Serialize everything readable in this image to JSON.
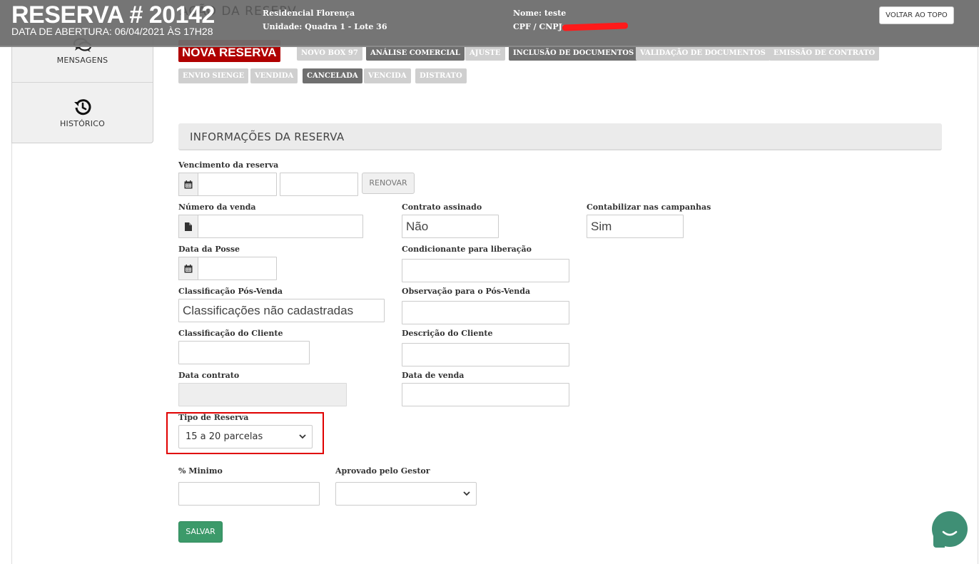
{
  "header": {
    "reservation_title": "RESERVA # 20142",
    "opening_date": "DATA DE ABERTURA: 06/04/2021 ÀS 17H28",
    "background_heading": "AÇÃO DA RESERV",
    "project": "Residencial Florença",
    "unit_line": "Unidade: Quadra 1 - Lote 36",
    "client_name": "Nome: teste",
    "client_doc_label": "CPF / CNPJ:",
    "back_to_top": "VOLTAR AO TOPO"
  },
  "sidebar": {
    "messages_label": "MENSAGENS",
    "history_label": "HISTÓRICO"
  },
  "status_tags": {
    "nova_reserva": "NOVA RESERVA",
    "novo_box": "NOVO BOX 97",
    "analise_comercial": "ANÁLISE COMERCIAL",
    "ajuste": "AJUSTE",
    "inclusao_documentos": "INCLUSÃO DE DOCUMENTOS",
    "validacao_documentos": "VALIDAÇÃO DE DOCUMENTOS",
    "emissao_contrato": "EMISSÃO DE CONTRATO",
    "envio_sienge": "ENVIO SIENGE",
    "vendida": "VENDIDA",
    "cancelada": "CANCELADA",
    "vencida": "VENCIDA",
    "distrato": "DISTRATO"
  },
  "section": {
    "title": "INFORMAÇÕES DA RESERVA"
  },
  "form": {
    "vencimento_label": "Vencimento da reserva",
    "renovar_label": "RENOVAR",
    "numero_venda_label": "Número da venda",
    "contrato_assinado_label": "Contrato assinado",
    "contrato_assinado_value": "Não",
    "contabilizar_label": "Contabilizar nas campanhas",
    "contabilizar_value": "Sim",
    "data_posse_label": "Data da Posse",
    "condicionante_label": "Condicionante para liberação",
    "classificacao_pos_venda_label": "Classificação Pós-Venda",
    "classificacao_pos_venda_value": "Classificações não cadastradas",
    "observacao_pos_venda_label": "Observação para o Pós-Venda",
    "classificacao_cliente_label": "Classificação do Cliente",
    "descricao_cliente_label": "Descrição do Cliente",
    "data_contrato_label": "Data contrato",
    "data_venda_label": "Data de venda",
    "tipo_reserva_label": "Tipo de Reserva",
    "tipo_reserva_value": "15 a 20 parcelas",
    "percentual_minimo_label": "% Minimo",
    "aprovado_gestor_label": "Aprovado pelo Gestor",
    "aprovado_gestor_value": "",
    "salvar_label": "SALVAR"
  },
  "colors": {
    "nova_reserva": "#b00000",
    "tag_dark": "#6f6f6f",
    "tag_light": "#cfcfcf",
    "salvar": "#3c9a6a",
    "highlight": "#e00000",
    "chat": "#3f8f75"
  },
  "icons": {
    "messages": "chat-bubbles-icon",
    "history": "history-clock-icon",
    "calendar": "calendar-icon",
    "document": "file-icon",
    "dropdown": "chevron-down-icon",
    "chat": "chat-widget-icon"
  }
}
